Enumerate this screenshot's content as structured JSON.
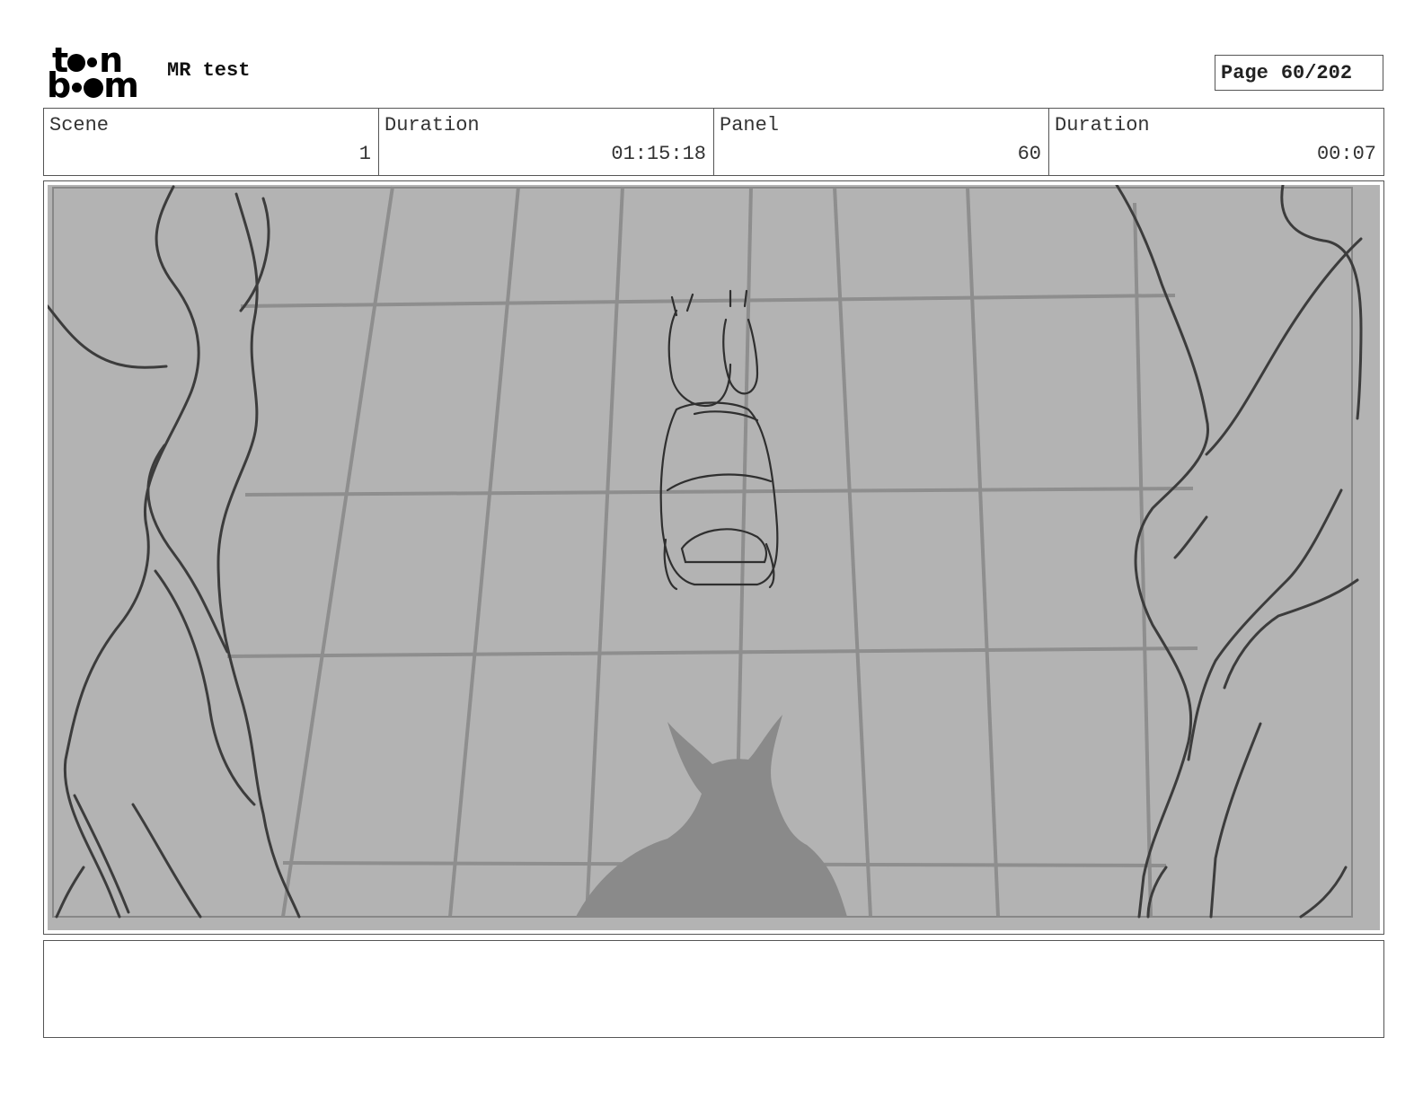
{
  "header": {
    "logo": {
      "line1": "toon",
      "line2": "boom"
    },
    "project_title": "MR test",
    "page_label": "Page",
    "page_value": "60/202"
  },
  "info": {
    "scene_label": "Scene",
    "scene_value": "1",
    "scene_duration_label": "Duration",
    "scene_duration_value": "01:15:18",
    "panel_label": "Panel",
    "panel_value": "60",
    "panel_duration_label": "Duration",
    "panel_duration_value": "00:07"
  },
  "panel_image": {
    "description_icon": "storyboard-sketch",
    "background_color": "#b3b3b3"
  },
  "notes": {
    "text": ""
  }
}
